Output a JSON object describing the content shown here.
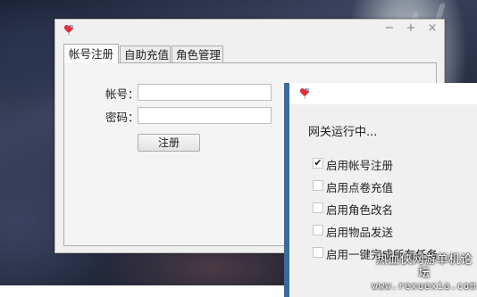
{
  "main_window": {
    "controls": {
      "minimize": "−",
      "maximize": "+",
      "close": "×"
    },
    "tabs": [
      {
        "label": "帐号注册",
        "active": true
      },
      {
        "label": "自助充值",
        "active": false
      },
      {
        "label": "角色管理",
        "active": false
      }
    ],
    "form": {
      "account_label": "帐号：",
      "account_value": "",
      "password_label": "密码：",
      "password_value": "",
      "register_button": "注册"
    }
  },
  "gateway_window": {
    "status": "网关运行中...",
    "options": [
      {
        "label": "启用帐号注册",
        "checked": true
      },
      {
        "label": "启用点卷充值",
        "checked": false
      },
      {
        "label": "启用角色改名",
        "checked": false
      },
      {
        "label": "启用物品发送",
        "checked": false
      },
      {
        "label": "启用一键完成所有任务",
        "checked": false
      }
    ]
  },
  "watermark": {
    "line1": "热血侠网游单机论坛",
    "line2": "www.rexuexia.com"
  },
  "icons": {
    "app": "heart-balloon-icon",
    "check": "✔"
  },
  "colors": {
    "accent_titlebar": "#3b6aa0",
    "window_bg": "#f0f0f0",
    "app_icon": "#e0303a"
  }
}
